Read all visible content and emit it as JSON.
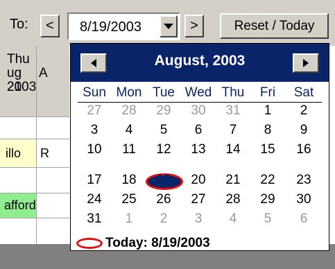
{
  "toolbar": {
    "to_label": "To:",
    "prev_label": "<",
    "next_label": ">",
    "date_value": "8/19/2003",
    "reset_label": "Reset / Today"
  },
  "grid": {
    "col1_header": [
      "Thu",
      "ug 21",
      "2003"
    ],
    "col2_header": "A",
    "cells": [
      "illo",
      "R",
      "afford"
    ]
  },
  "calendar": {
    "title": "August, 2003",
    "days_of_week": [
      "Sun",
      "Mon",
      "Tue",
      "Wed",
      "Thu",
      "Fri",
      "Sat"
    ],
    "weeks": [
      [
        {
          "d": "27",
          "o": true
        },
        {
          "d": "28",
          "o": true
        },
        {
          "d": "29",
          "o": true
        },
        {
          "d": "30",
          "o": true
        },
        {
          "d": "31",
          "o": true
        },
        {
          "d": "1"
        },
        {
          "d": "2"
        }
      ],
      [
        {
          "d": "3"
        },
        {
          "d": "4"
        },
        {
          "d": "5"
        },
        {
          "d": "6"
        },
        {
          "d": "7"
        },
        {
          "d": "8"
        },
        {
          "d": "9"
        }
      ],
      [
        {
          "d": "10"
        },
        {
          "d": "11"
        },
        {
          "d": "12"
        },
        {
          "d": "13"
        },
        {
          "d": "14"
        },
        {
          "d": "15"
        },
        {
          "d": "16"
        }
      ],
      [
        {
          "d": "17"
        },
        {
          "d": "18"
        },
        {
          "d": "19",
          "sel": true
        },
        {
          "d": "20"
        },
        {
          "d": "21"
        },
        {
          "d": "22"
        },
        {
          "d": "23"
        }
      ],
      [
        {
          "d": "24"
        },
        {
          "d": "25"
        },
        {
          "d": "26"
        },
        {
          "d": "27"
        },
        {
          "d": "28"
        },
        {
          "d": "29"
        },
        {
          "d": "30"
        }
      ],
      [
        {
          "d": "31"
        },
        {
          "d": "1",
          "o": true
        },
        {
          "d": "2",
          "o": true
        },
        {
          "d": "3",
          "o": true
        },
        {
          "d": "4",
          "o": true
        },
        {
          "d": "5",
          "o": true
        },
        {
          "d": "6",
          "o": true
        }
      ]
    ],
    "today_label": "Today: 8/19/2003"
  },
  "colors": {
    "header_bg": "#0a246a",
    "selected_circle": "#e01010",
    "highlight_yellow": "#ffffcc",
    "highlight_green": "#90ee90"
  }
}
